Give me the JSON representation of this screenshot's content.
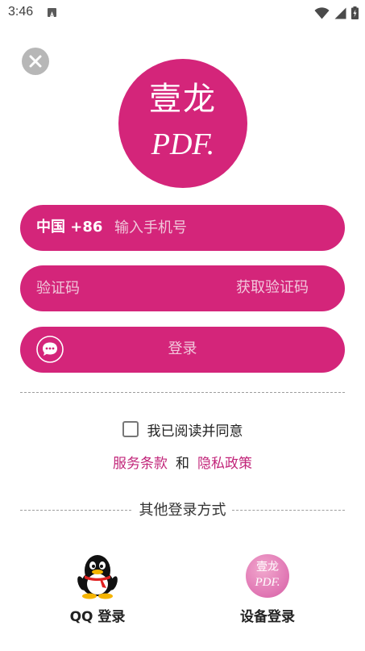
{
  "status_bar": {
    "time": "3:46",
    "icons": [
      "notification-a-icon",
      "wifi-icon",
      "signal-icon",
      "battery-charging-icon"
    ]
  },
  "colors": {
    "brand": "#d4257a",
    "link": "#c2267a",
    "close_bg": "#b7b7b7"
  },
  "logo": {
    "line1": "壹龙",
    "line2": "PDF."
  },
  "phone": {
    "country_code": "中国 +86",
    "placeholder": "输入手机号",
    "value": ""
  },
  "code": {
    "placeholder": "验证码",
    "value": "",
    "get_code_label": "获取验证码"
  },
  "login": {
    "label": "登录"
  },
  "agreement": {
    "checked": false,
    "text": "我已阅读并同意",
    "terms": "服务条款",
    "and": "和",
    "privacy": "隐私政策"
  },
  "other_login": {
    "title": "其他登录方式",
    "options": [
      {
        "label": "QQ 登录",
        "icon": "qq-penguin-icon"
      },
      {
        "label": "设备登录",
        "icon": "device-logo-icon"
      }
    ]
  }
}
